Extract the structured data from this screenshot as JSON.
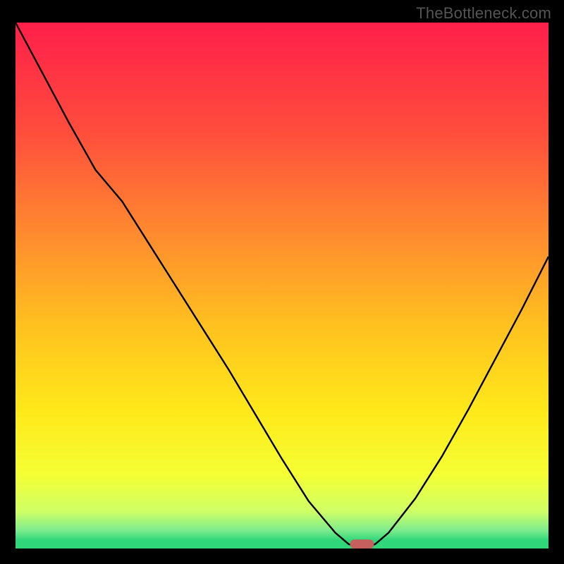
{
  "watermark": "TheBottleneck.com",
  "colors": {
    "frame": "#000000",
    "watermark_text": "#555555",
    "curve": "#000000",
    "marker_fill": "#c6605f",
    "gradient_stops": [
      {
        "offset": 0.0,
        "color": "#ff1f4a"
      },
      {
        "offset": 0.2,
        "color": "#ff4b3d"
      },
      {
        "offset": 0.4,
        "color": "#ff8a2f"
      },
      {
        "offset": 0.58,
        "color": "#ffc21f"
      },
      {
        "offset": 0.74,
        "color": "#ffe91a"
      },
      {
        "offset": 0.86,
        "color": "#f4ff34"
      },
      {
        "offset": 0.93,
        "color": "#cfff66"
      },
      {
        "offset": 0.965,
        "color": "#7eec8d"
      },
      {
        "offset": 0.985,
        "color": "#2fd67a"
      },
      {
        "offset": 1.0,
        "color": "#2fd67a"
      }
    ]
  },
  "chart_data": {
    "type": "line",
    "title": "",
    "xlabel": "",
    "ylabel": "",
    "x": [
      0.0,
      0.05,
      0.1,
      0.15,
      0.2,
      0.25,
      0.3,
      0.35,
      0.4,
      0.45,
      0.5,
      0.55,
      0.6,
      0.625,
      0.65,
      0.675,
      0.7,
      0.75,
      0.8,
      0.85,
      0.9,
      0.95,
      1.0
    ],
    "values": [
      1.0,
      0.905,
      0.81,
      0.72,
      0.66,
      0.58,
      0.5,
      0.42,
      0.34,
      0.255,
      0.17,
      0.09,
      0.03,
      0.0083,
      0.0,
      0.0083,
      0.03,
      0.095,
      0.175,
      0.265,
      0.36,
      0.455,
      0.555
    ],
    "xlim": [
      0,
      1
    ],
    "ylim": [
      0,
      1
    ],
    "marker": {
      "x": 0.65,
      "y": 0.0083
    },
    "notes": "Values are normalized; y=0 at bottom baseline, y=1 at top of plot. Curve minimum near x≈0.65."
  }
}
